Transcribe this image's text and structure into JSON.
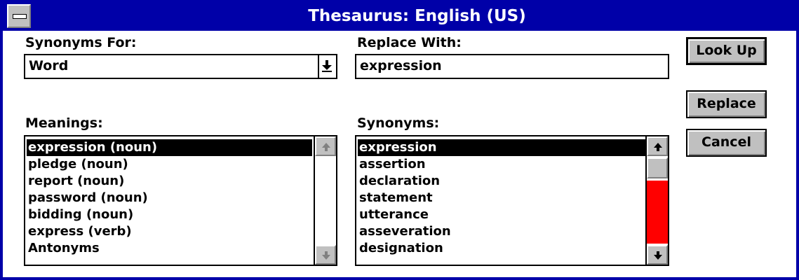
{
  "window": {
    "title": "Thesaurus: English (US)"
  },
  "synonyms_for": {
    "label": "Synonyms For:",
    "value": "Word"
  },
  "replace_with": {
    "label": "Replace With:",
    "value": "expression"
  },
  "meanings": {
    "label": "Meanings:",
    "items": [
      "expression (noun)",
      "pledge (noun)",
      "report (noun)",
      "password (noun)",
      "bidding (noun)",
      "express (verb)",
      "Antonyms"
    ],
    "selected": "expression (noun)"
  },
  "synonyms": {
    "label": "Synonyms:",
    "items": [
      "expression",
      "assertion",
      "declaration",
      "statement",
      "utterance",
      "asseveration",
      "designation"
    ],
    "selected": "expression"
  },
  "buttons": {
    "look_up": "Look Up",
    "replace": "Replace",
    "cancel": "Cancel"
  },
  "colors": {
    "title_bar": "#0000a8",
    "scroll_track_highlight": "#ff0000",
    "button_face": "#c0c0c0"
  }
}
